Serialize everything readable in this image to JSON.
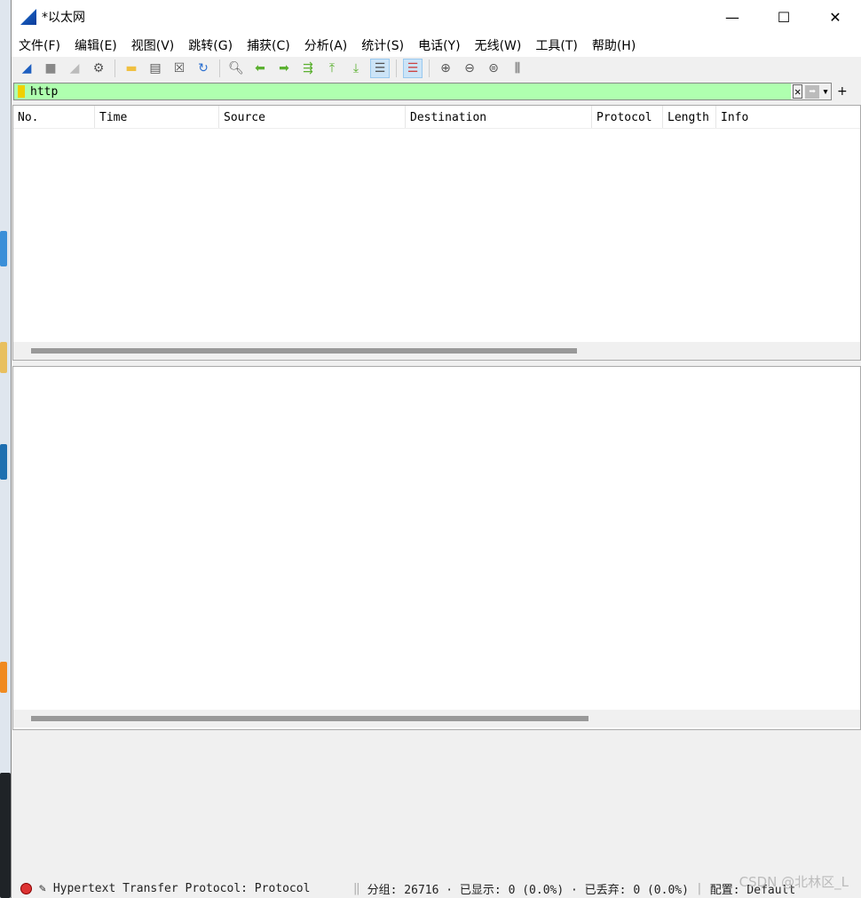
{
  "window": {
    "title": "*以太网",
    "minimize": "—",
    "maximize": "☐",
    "close": "✕"
  },
  "menu": [
    "文件(F)",
    "编辑(E)",
    "视图(V)",
    "跳转(G)",
    "捕获(C)",
    "分析(A)",
    "统计(S)",
    "电话(Y)",
    "无线(W)",
    "工具(T)",
    "帮助(H)"
  ],
  "filter": {
    "value": "http",
    "clear": "✕",
    "apply": "➡",
    "dropdown": "▾",
    "add": "+"
  },
  "columns": [
    "No.",
    "Time",
    "Source",
    "Destination",
    "Protocol",
    "Length",
    "Info"
  ],
  "status": {
    "field": "Hypertext Transfer Protocol: Protocol",
    "packets": "分组: 26716 · 已显示: 0 (0.0%) · 已丢弃: 0 (0.0%)",
    "profile": "配置: Default"
  },
  "watermark": "CSDN @北林区_L"
}
